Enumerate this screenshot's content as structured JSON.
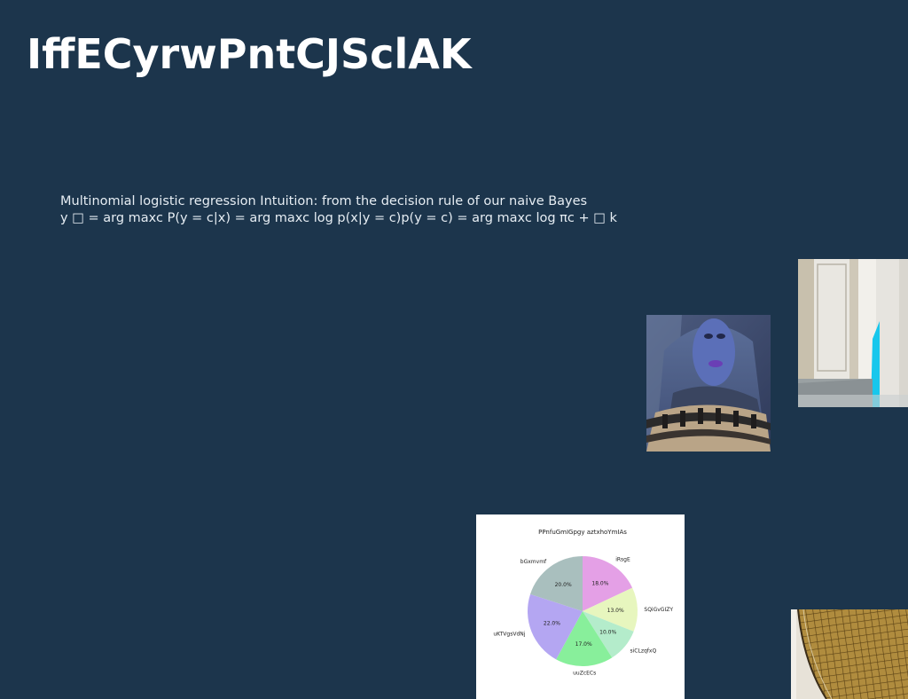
{
  "slide": {
    "title": "IffECyrwPntCJSclAK",
    "body_lines": [
      "Multinomial logistic regression Intuition: from the decision rule of our naive Bayes",
      "y □ = arg maxc P(y = c|x) = arg maxc log p(x|y = c)p(y = c) = arg maxc log πc + □ k"
    ]
  },
  "colors": {
    "background": "#1c354c",
    "title": "#ffffff",
    "body_text": "#e6edf3"
  },
  "chart_data": {
    "type": "pie",
    "title": "PPnfuGmIGpgy aztxhoYmIAs",
    "categories": [
      "iRsgE",
      "SQiGvGIZY",
      "siCLzqfxQ",
      "uuZcECs",
      "uKTVgsVdNj",
      "bGxmvmf"
    ],
    "values": [
      18.0,
      13.0,
      10.0,
      17.0,
      22.0,
      20.0
    ],
    "value_labels": [
      "18.0%",
      "13.0%",
      "10.0%",
      "17.0%",
      "22.0%",
      "20.0%"
    ],
    "colors": [
      "#e4a0e6",
      "#e7f6be",
      "#b4eccb",
      "#88ef9b",
      "#b4a6f2",
      "#a9bfbe"
    ],
    "start_angle_deg": 90,
    "direction": "clockwise"
  }
}
